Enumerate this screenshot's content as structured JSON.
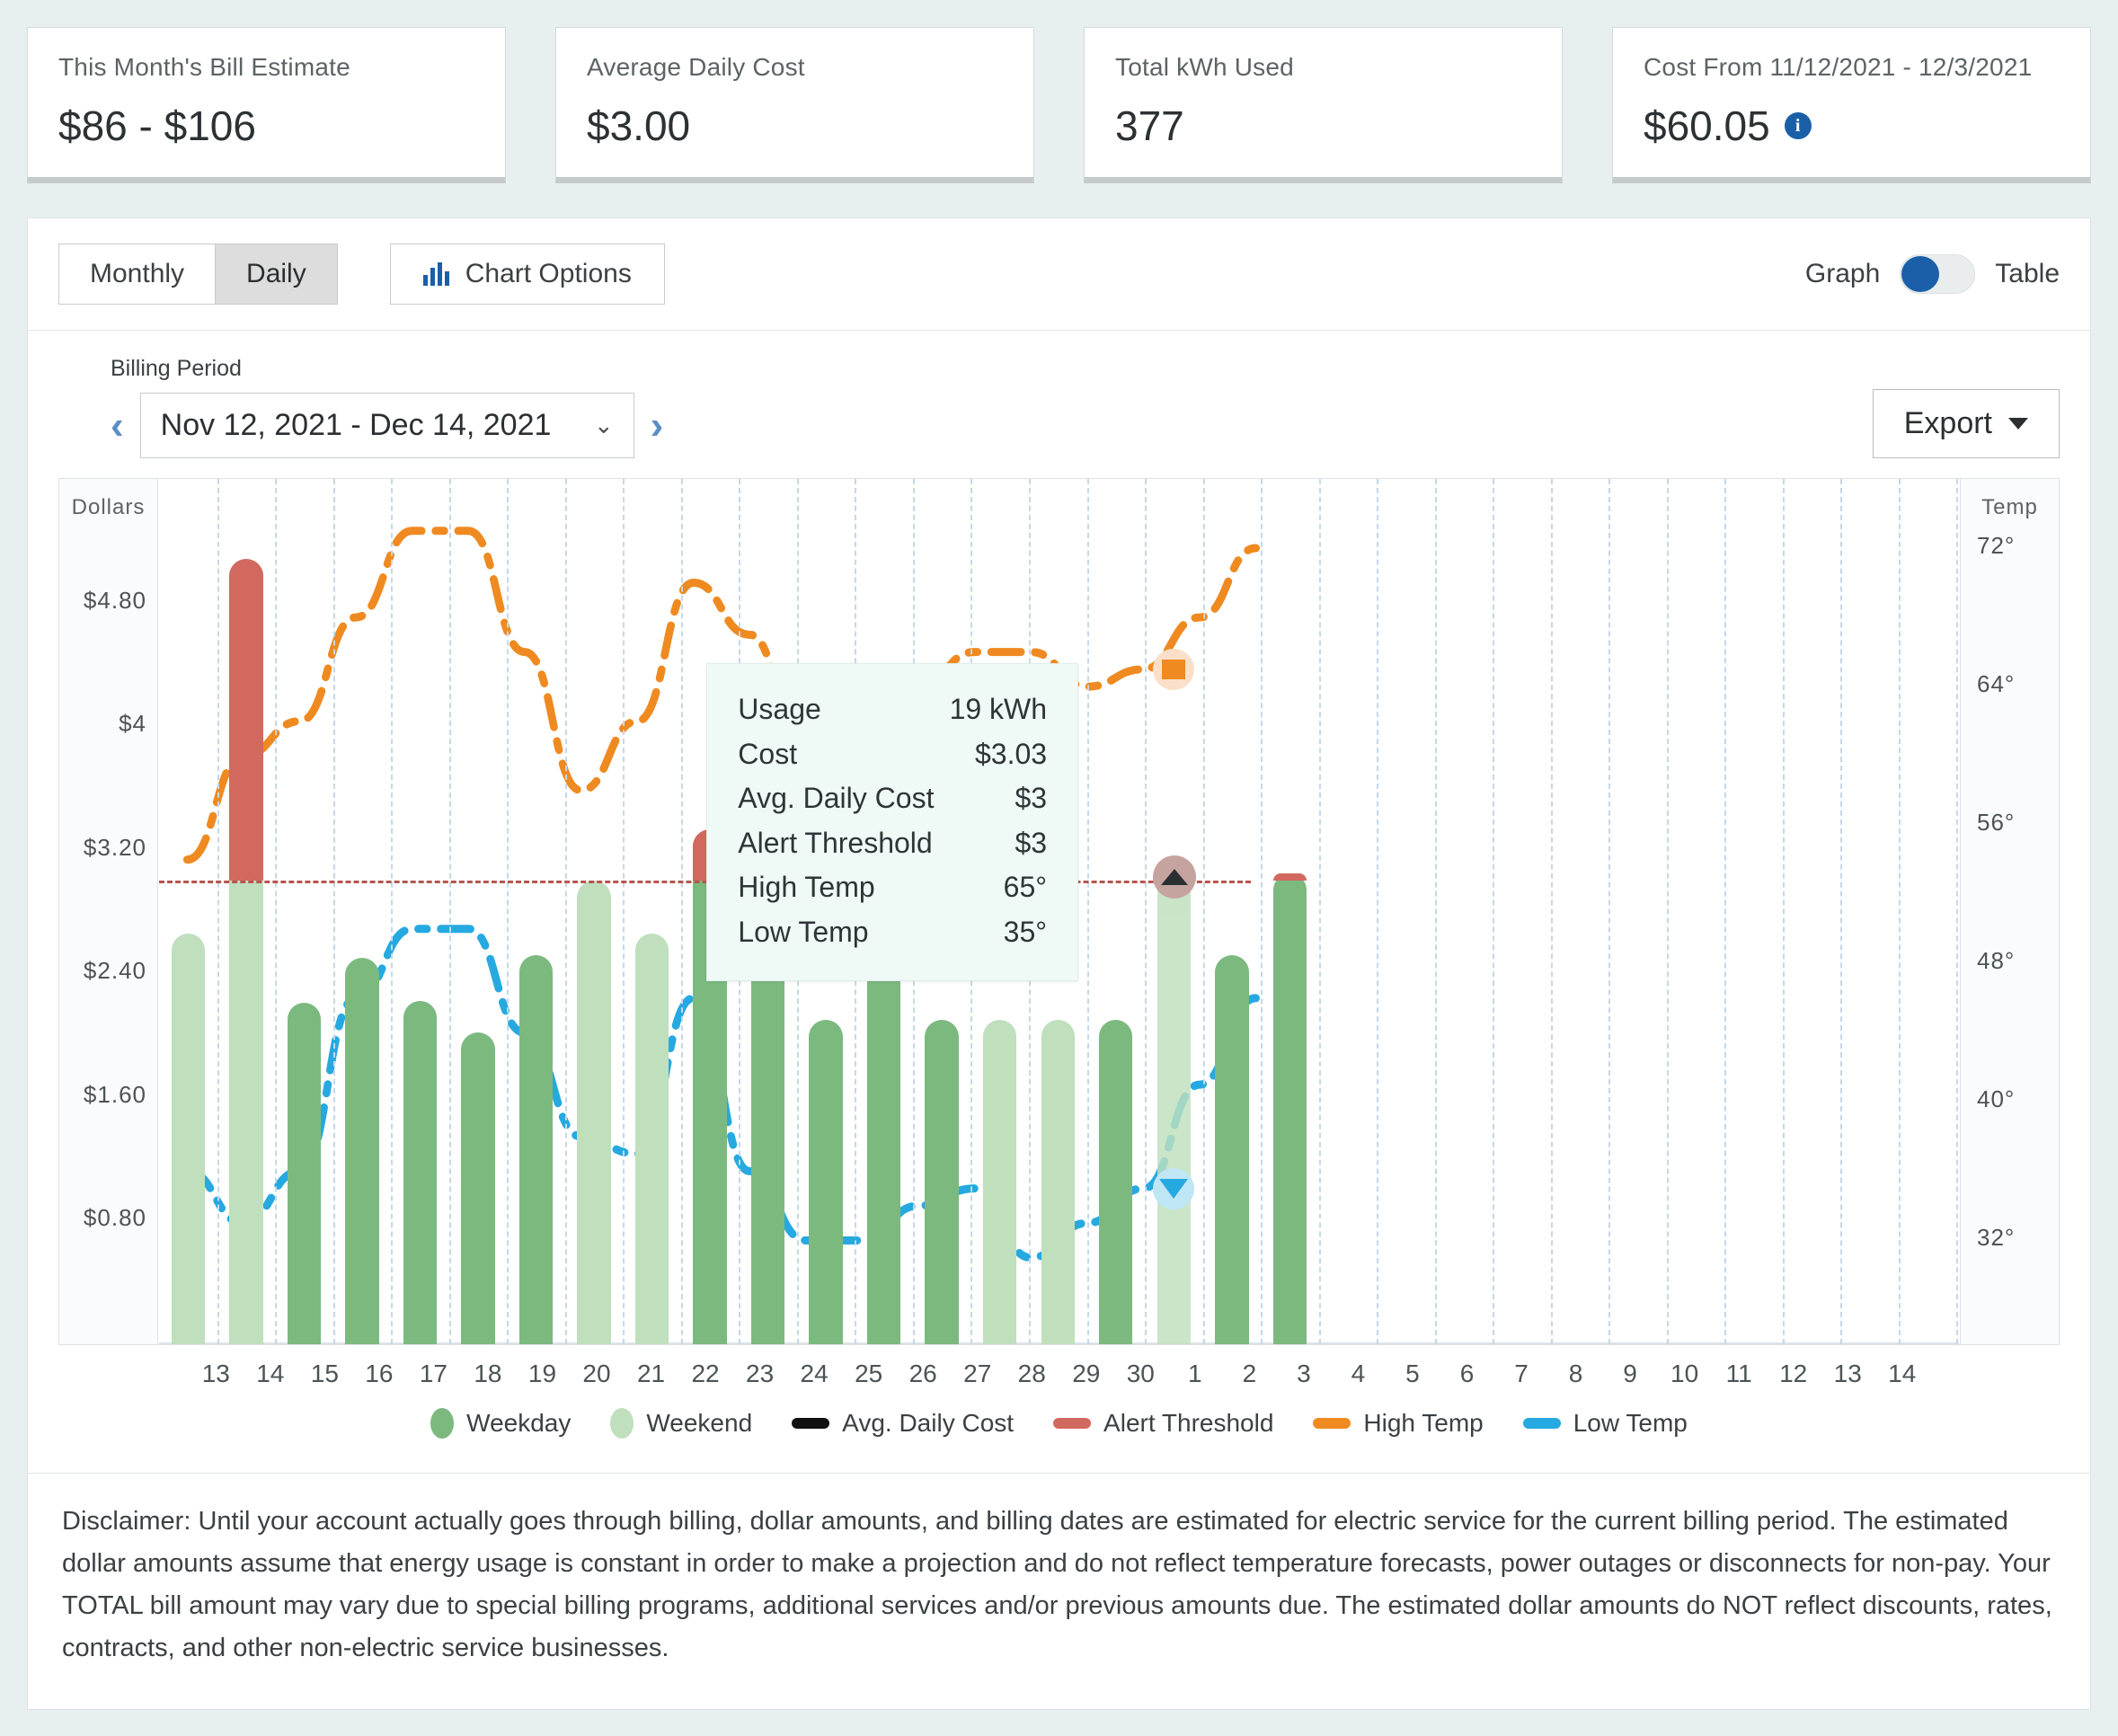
{
  "cards": [
    {
      "label": "This Month's Bill Estimate",
      "value": "$86 - $106",
      "info": false
    },
    {
      "label": "Average Daily Cost",
      "value": "$3.00",
      "info": false
    },
    {
      "label": "Total kWh Used",
      "value": "377",
      "info": false
    },
    {
      "label": "Cost From 11/12/2021 - 12/3/2021",
      "value": "$60.05",
      "info": true,
      "info_glyph": "i"
    }
  ],
  "toolbar": {
    "monthly_label": "Monthly",
    "daily_label": "Daily",
    "active_tab": "Daily",
    "chart_options_label": "Chart Options",
    "graph_label": "Graph",
    "table_label": "Table",
    "toggle_state": "Graph"
  },
  "period": {
    "label": "Billing Period",
    "value": "Nov 12, 2021 - Dec 14, 2021",
    "prev_glyph": "‹",
    "next_glyph": "›",
    "caret_glyph": "⌄",
    "export_label": "Export"
  },
  "tooltip": {
    "rows": [
      {
        "label": "Usage",
        "value": "19 kWh"
      },
      {
        "label": "Cost",
        "value": "$3.03"
      },
      {
        "label": "Avg. Daily Cost",
        "value": "$3"
      },
      {
        "label": "Alert Threshold",
        "value": "$3"
      },
      {
        "label": "High Temp",
        "value": "65°"
      },
      {
        "label": "Low Temp",
        "value": "35°"
      }
    ]
  },
  "legend": [
    {
      "label": "Weekday",
      "type": "dot",
      "color": "#7cb97f"
    },
    {
      "label": "Weekend",
      "type": "dot",
      "color": "#bfdfbd"
    },
    {
      "label": "Avg. Daily Cost",
      "type": "line",
      "color": "#111111"
    },
    {
      "label": "Alert Threshold",
      "type": "line",
      "color": "#d2695f"
    },
    {
      "label": "High Temp",
      "type": "line",
      "color": "#ef8a21"
    },
    {
      "label": "Low Temp",
      "type": "line",
      "color": "#26a9e0"
    }
  ],
  "disclaimer": "Disclaimer: Until your account actually goes through billing, dollar amounts, and billing dates are estimated for electric service for the current billing period. The estimated dollar amounts assume that energy usage is constant in order to make a projection and do not reflect temperature forecasts, power outages or disconnects for non-pay. Your TOTAL bill amount may vary due to special billing programs, additional services and/or previous amounts due. The estimated dollar amounts do NOT reflect discounts, rates, contracts, and other non-electric service businesses.",
  "chart_data": {
    "type": "bar",
    "title": "",
    "xlabel": "",
    "ylabel": "Dollars",
    "y2label": "Temp",
    "ylim": [
      0,
      5.6
    ],
    "y2lim": [
      26,
      76
    ],
    "grid": true,
    "legend_position": "bottom",
    "yticks": [
      "$0.80",
      "$1.60",
      "$2.40",
      "$3.20",
      "$4",
      "$4.80"
    ],
    "ytick_values": [
      0.8,
      1.6,
      2.4,
      3.2,
      4.0,
      4.8
    ],
    "y2ticks": [
      "32°",
      "40°",
      "48°",
      "56°",
      "64°",
      "72°"
    ],
    "y2tick_values": [
      32,
      40,
      48,
      56,
      64,
      72
    ],
    "alert_threshold": 3.0,
    "avg_daily_cost": 3.0,
    "categories": [
      "13",
      "14",
      "15",
      "16",
      "17",
      "18",
      "19",
      "20",
      "21",
      "22",
      "23",
      "24",
      "25",
      "26",
      "27",
      "28",
      "29",
      "30",
      "1",
      "2",
      "3",
      "4",
      "5",
      "6",
      "7",
      "8",
      "9",
      "10",
      "11",
      "12",
      "13",
      "14"
    ],
    "series": [
      {
        "name": "Daily Cost",
        "values": [
          2.66,
          5.08,
          2.21,
          2.5,
          2.22,
          2.02,
          2.52,
          3.0,
          2.66,
          3.33,
          3.34,
          2.1,
          4.2,
          2.1,
          2.1,
          2.1,
          2.1,
          3.03,
          2.52,
          3.05,
          null,
          null,
          null,
          null,
          null,
          null,
          null,
          null,
          null,
          null,
          null,
          null
        ],
        "daytype": [
          "weekend",
          "weekend",
          "weekday",
          "weekday",
          "weekday",
          "weekday",
          "weekday",
          "weekend",
          "weekend",
          "weekday",
          "weekday",
          "weekday",
          "weekday",
          "weekday",
          "weekend",
          "weekend",
          "weekday",
          "weekend",
          "weekday",
          "weekday",
          null,
          null,
          null,
          null,
          null,
          null,
          null,
          null,
          null,
          null,
          null,
          null
        ]
      },
      {
        "name": "High Temp",
        "values": [
          54,
          60,
          62,
          68,
          73,
          73,
          66,
          58,
          62,
          70,
          67,
          60,
          57,
          64,
          66,
          66,
          64,
          65,
          68,
          72,
          null,
          null,
          null,
          null,
          null,
          null,
          null,
          null,
          null,
          null,
          null,
          null
        ]
      },
      {
        "name": "Low Temp",
        "values": [
          36,
          33,
          36,
          46,
          50,
          50,
          44,
          38,
          37,
          46,
          36,
          32,
          32,
          34,
          35,
          31,
          33,
          35,
          41,
          46,
          null,
          null,
          null,
          null,
          null,
          null,
          null,
          null,
          null,
          null,
          null,
          null
        ]
      }
    ],
    "hovered_category": "30",
    "hovered_values": {
      "usage_kwh": 19,
      "cost": 3.03,
      "avg_daily_cost": 3,
      "alert_threshold": 3,
      "high_temp": 65,
      "low_temp": 35
    }
  }
}
